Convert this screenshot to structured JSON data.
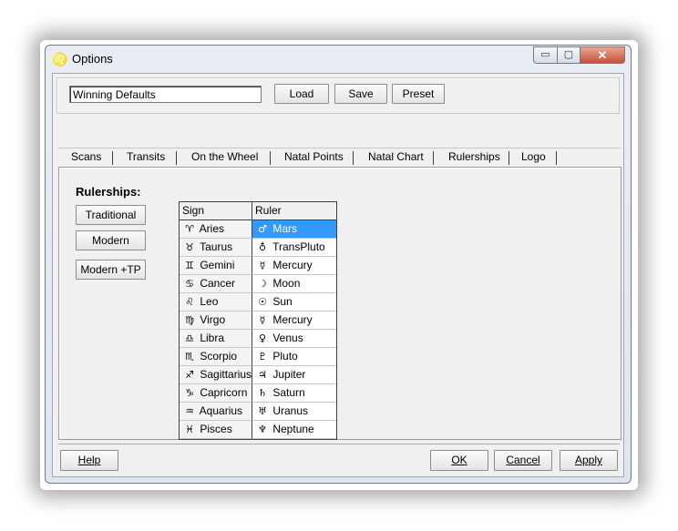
{
  "window": {
    "title": "Options",
    "icon": "astro-app-icon",
    "controls": {
      "minimize": "▭",
      "maximize": "▢",
      "close": "✕"
    }
  },
  "preset": {
    "value": "Winning Defaults",
    "load_label": "Load",
    "save_label": "Save",
    "preset_label": "Preset"
  },
  "tabs": [
    "Scans",
    "Transits",
    "On the Wheel",
    "Natal Points",
    "Natal Chart",
    "Rulerships",
    "Logo"
  ],
  "active_tab": "Rulerships",
  "rulerships": {
    "title": "Rulerships:",
    "buttons": {
      "traditional": "Traditional",
      "modern": "Modern",
      "modern_tp": "Modern +TP"
    },
    "columns": {
      "sign": "Sign",
      "ruler": "Ruler"
    },
    "rows": [
      {
        "sign": "Aries",
        "sign_glyph": "♈",
        "ruler": "Mars",
        "ruler_glyph": "♂"
      },
      {
        "sign": "Taurus",
        "sign_glyph": "♉",
        "ruler": "TransPluto",
        "ruler_glyph": "♁"
      },
      {
        "sign": "Gemini",
        "sign_glyph": "♊",
        "ruler": "Mercury",
        "ruler_glyph": "☿"
      },
      {
        "sign": "Cancer",
        "sign_glyph": "♋",
        "ruler": "Moon",
        "ruler_glyph": "☽"
      },
      {
        "sign": "Leo",
        "sign_glyph": "♌",
        "ruler": "Sun",
        "ruler_glyph": "☉"
      },
      {
        "sign": "Virgo",
        "sign_glyph": "♍",
        "ruler": "Mercury",
        "ruler_glyph": "☿"
      },
      {
        "sign": "Libra",
        "sign_glyph": "♎",
        "ruler": "Venus",
        "ruler_glyph": "♀"
      },
      {
        "sign": "Scorpio",
        "sign_glyph": "♏",
        "ruler": "Pluto",
        "ruler_glyph": "♇"
      },
      {
        "sign": "Sagittarius",
        "sign_glyph": "♐",
        "ruler": "Jupiter",
        "ruler_glyph": "♃"
      },
      {
        "sign": "Capricorn",
        "sign_glyph": "♑",
        "ruler": "Saturn",
        "ruler_glyph": "♄"
      },
      {
        "sign": "Aquarius",
        "sign_glyph": "♒",
        "ruler": "Uranus",
        "ruler_glyph": "♅"
      },
      {
        "sign": "Pisces",
        "sign_glyph": "♓",
        "ruler": "Neptune",
        "ruler_glyph": "♆"
      }
    ],
    "selected_row": 0
  },
  "footer": {
    "help_label": "Help",
    "ok_label": "OK",
    "cancel_label": "Cancel",
    "apply_label": "Apply"
  },
  "colors": {
    "selection": "#3399ff",
    "close_button": "#c7503a"
  }
}
